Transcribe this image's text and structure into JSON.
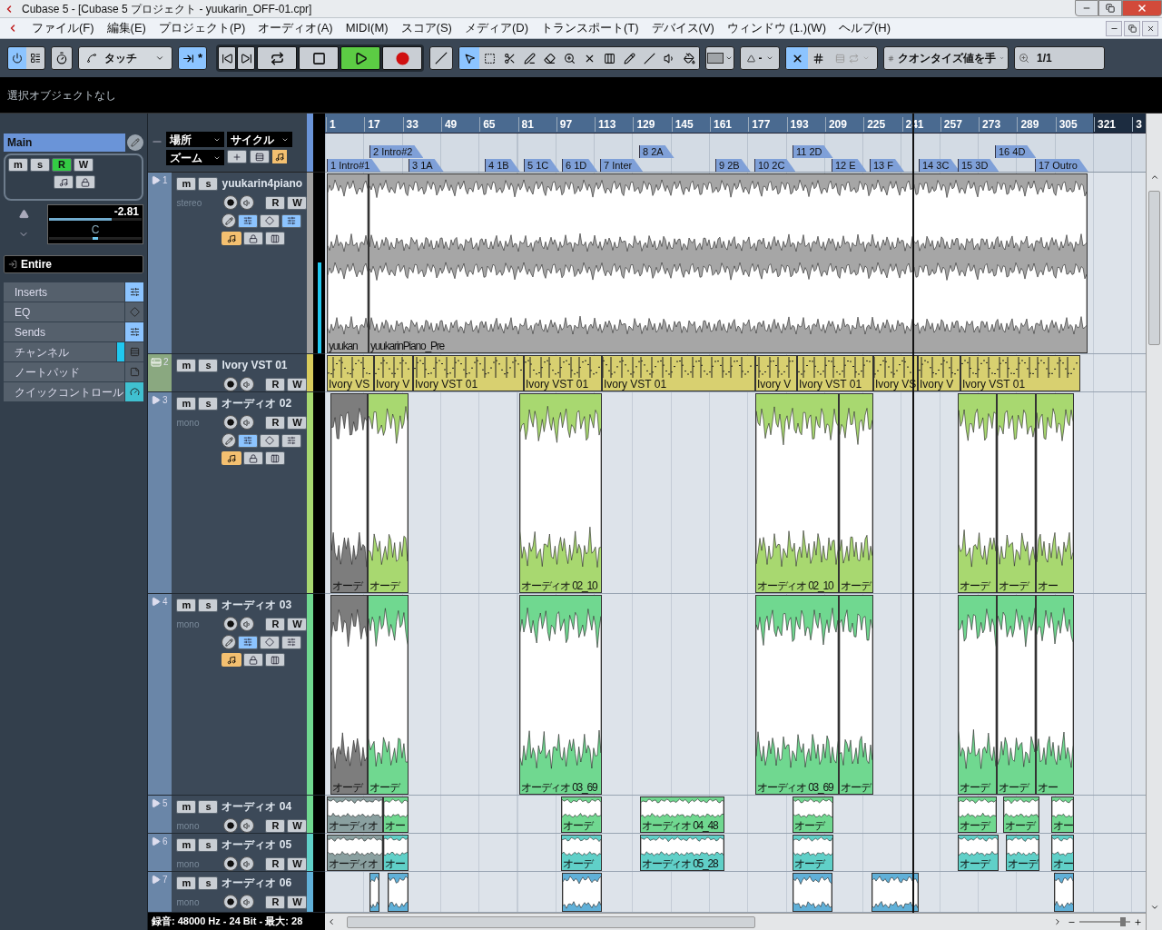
{
  "window": {
    "title": "Cubase 5 - [Cubase 5 プロジェクト - yuukarin_OFF-01.cpr]"
  },
  "menu": [
    "ファイル(F)",
    "編集(E)",
    "プロジェクト(P)",
    "オーディオ(A)",
    "MIDI(M)",
    "スコア(S)",
    "メディア(D)",
    "トランスポート(T)",
    "デバイス(V)",
    "ウィンドウ (1.)(W)",
    "ヘルプ(H)"
  ],
  "toolbar": {
    "automation_mode": "タッチ",
    "autoscroll_mark": "*",
    "autoscroll_on": true,
    "transport": [
      {
        "kind": "to-start",
        "on": false
      },
      {
        "kind": "cycle",
        "on": false
      },
      {
        "kind": "stop",
        "on": false
      },
      {
        "kind": "play",
        "on": true
      },
      {
        "kind": "record",
        "on": false
      }
    ],
    "tools": [
      {
        "kind": "object",
        "selected": true
      },
      {
        "kind": "range",
        "selected": false
      },
      {
        "kind": "split",
        "selected": false
      },
      {
        "kind": "glue",
        "selected": false
      },
      {
        "kind": "erase",
        "selected": false
      },
      {
        "kind": "zoom",
        "selected": false
      },
      {
        "kind": "mute",
        "selected": false
      },
      {
        "kind": "timewarp",
        "selected": false
      },
      {
        "kind": "draw",
        "selected": false
      },
      {
        "kind": "line",
        "selected": false
      },
      {
        "kind": "play",
        "selected": false
      },
      {
        "kind": "color",
        "selected": false
      }
    ],
    "curve_value": "-",
    "snap_on": true,
    "quantize_type": "クオンタイズ値を手",
    "quantize_value": "1/1"
  },
  "info_line": "選択オブジェクトなし",
  "inspector": {
    "track_name": "Main",
    "labels": {
      "mute": "m",
      "solo": "s",
      "read": "R",
      "write": "W"
    },
    "read_on": true,
    "volume": {
      "reading": "-2.81",
      "level": 0.68
    },
    "pan": {
      "reading": "C",
      "level": 0.5
    },
    "routing": "Entire",
    "sections": [
      {
        "label": "Inserts",
        "kind": "inserts"
      },
      {
        "label": "EQ",
        "kind": "eq"
      },
      {
        "label": "Sends",
        "kind": "sends"
      },
      {
        "label": "チャンネル",
        "kind": "channel"
      },
      {
        "label": "ノートパッド",
        "kind": "notepad"
      },
      {
        "label": "クイックコントロール",
        "kind": "quick"
      }
    ]
  },
  "track_list_header": {
    "locate": "場所",
    "cycle": "サイクル",
    "zoom": "ズーム"
  },
  "ruler": {
    "ticks": [
      "1",
      "17",
      "33",
      "49",
      "65",
      "81",
      "97",
      "113",
      "129",
      "145",
      "161",
      "177",
      "193",
      "209",
      "225",
      "241",
      "257",
      "273",
      "289",
      "305",
      "321",
      "3"
    ]
  },
  "markers": [
    {
      "label": "1 Intro#1",
      "upper": false
    },
    {
      "label": "2 Intro#2",
      "upper": true
    },
    {
      "label": "3 1A",
      "upper": false
    },
    {
      "label": "4 1B",
      "upper": false
    },
    {
      "label": "5 1C",
      "upper": false
    },
    {
      "label": "6 1D",
      "upper": false
    },
    {
      "label": "7 Inter",
      "upper": false
    },
    {
      "label": "8 2A",
      "upper": true
    },
    {
      "label": "9 2B",
      "upper": false
    },
    {
      "label": "10 2C",
      "upper": false
    },
    {
      "label": "11 2D",
      "upper": true
    },
    {
      "label": "12 E",
      "upper": false
    },
    {
      "label": "13 F",
      "upper": false
    },
    {
      "label": "14 3C",
      "upper": false
    },
    {
      "label": "15 3D",
      "upper": false
    },
    {
      "label": "16 4D",
      "upper": true
    },
    {
      "label": "17 Outro",
      "upper": false
    }
  ],
  "zoom_slider": {
    "level": 0.85
  },
  "tracks": [
    {
      "number": "1",
      "name": "yuukarin4piano",
      "kind": "audio",
      "channel": "stereo",
      "color": "#a0a0a0",
      "labels": {
        "mute": "m",
        "solo": "s",
        "read": "R",
        "write": "W"
      },
      "inserts_on": true,
      "sends_on": true,
      "events": [
        {
          "label": "yuukan",
          "color": "#a6a6a6"
        },
        {
          "label": "yuukarinPiano_Pre",
          "color": "#a6a6a6"
        }
      ]
    },
    {
      "number": "2",
      "name": "Ivory VST 01",
      "kind": "instrument",
      "color": "#d8cc5c",
      "labels": {
        "mute": "m",
        "solo": "s",
        "read": "R",
        "write": "W"
      },
      "events": [
        {
          "label": "Ivory VS",
          "color": "#d8d070"
        },
        {
          "label": "Ivory V",
          "color": "#d8d070"
        },
        {
          "label": "Ivory VST 01",
          "color": "#d8d070"
        },
        {
          "label": "Ivory VST 01",
          "color": "#d8d070"
        },
        {
          "label": "Ivory VST 01",
          "color": "#d8d070"
        },
        {
          "label": "Ivory V",
          "color": "#d8d070"
        },
        {
          "label": "Ivory VST 01",
          "color": "#d8d070"
        },
        {
          "label": "Ivory VS",
          "color": "#d8d070"
        },
        {
          "label": "Ivory V",
          "color": "#d8d070"
        },
        {
          "label": "Ivory VST 01",
          "color": "#d8d070"
        }
      ]
    },
    {
      "number": "3",
      "name": "オーディオ 02",
      "kind": "audio",
      "channel": "mono",
      "color": "#a8d870",
      "labels": {
        "mute": "m",
        "solo": "s",
        "read": "R",
        "write": "W"
      },
      "inserts_on": true,
      "sends_on": false,
      "events": [
        {
          "label": "オーデ",
          "color": "#7d7d7d"
        },
        {
          "label": "オーデ",
          "color": "#a8d870"
        },
        {
          "label": "オーディオ 02_10",
          "color": "#a8d870"
        },
        {
          "label": "オーディオ 02_10",
          "color": "#a8d870"
        },
        {
          "label": "オーデ",
          "color": "#a8d870"
        },
        {
          "label": "オーデ",
          "color": "#a8d870"
        },
        {
          "label": "オーデ",
          "color": "#a8d870"
        },
        {
          "label": "オー",
          "color": "#a8d870"
        }
      ]
    },
    {
      "number": "4",
      "name": "オーディオ 03",
      "kind": "audio",
      "channel": "mono",
      "color": "#70d890",
      "labels": {
        "mute": "m",
        "solo": "s",
        "read": "R",
        "write": "W"
      },
      "inserts_on": true,
      "sends_on": false,
      "events": [
        {
          "label": "オーデ",
          "color": "#7d7d7d"
        },
        {
          "label": "オーデ",
          "color": "#70d890"
        },
        {
          "label": "オーディオ 03_69",
          "color": "#70d890"
        },
        {
          "label": "オーディオ 03_69",
          "color": "#70d890"
        },
        {
          "label": "オーデ",
          "color": "#70d890"
        },
        {
          "label": "オーデ",
          "color": "#70d890"
        },
        {
          "label": "オーデ",
          "color": "#70d890"
        },
        {
          "label": "オー",
          "color": "#70d890"
        }
      ]
    },
    {
      "number": "5",
      "name": "オーディオ 04",
      "kind": "audio",
      "channel": "mono",
      "color": "#70d890",
      "labels": {
        "mute": "m",
        "solo": "s",
        "read": "R",
        "write": "W"
      },
      "events": [
        {
          "label": "オーディオ",
          "color": "#8aa0a0"
        },
        {
          "label": "オー",
          "color": "#70d890"
        },
        {
          "label": "オーデ",
          "color": "#70d890"
        },
        {
          "label": "オーディオ 04_48",
          "color": "#70d890"
        },
        {
          "label": "オーデ",
          "color": "#70d890"
        },
        {
          "label": "オーデ",
          "color": "#70d890"
        },
        {
          "label": "オーデ",
          "color": "#70d890"
        },
        {
          "label": "オー",
          "color": "#70d890"
        }
      ]
    },
    {
      "number": "6",
      "name": "オーディオ 05",
      "kind": "audio",
      "channel": "mono",
      "color": "#60d0c8",
      "labels": {
        "mute": "m",
        "solo": "s",
        "read": "R",
        "write": "W"
      },
      "events": [
        {
          "label": "オーディオ",
          "color": "#8aa0a0"
        },
        {
          "label": "オー",
          "color": "#60d0c8"
        },
        {
          "label": "オーデ",
          "color": "#60d0c8"
        },
        {
          "label": "オーディオ 05_28",
          "color": "#60d0c8"
        },
        {
          "label": "オーデ",
          "color": "#60d0c8"
        },
        {
          "label": "オーデ",
          "color": "#60d0c8"
        },
        {
          "label": "オーデ",
          "color": "#60d0c8"
        },
        {
          "label": "オー",
          "color": "#60d0c8"
        }
      ]
    },
    {
      "number": "7",
      "name": "オーディオ 06",
      "kind": "audio",
      "channel": "mono",
      "color": "#60b0d8",
      "labels": {
        "mute": "m",
        "solo": "s",
        "read": "R",
        "write": "W"
      },
      "events": [
        {
          "color": "#60b0d8"
        },
        {
          "color": "#60b0d8"
        },
        {
          "color": "#60b0d8"
        },
        {
          "color": "#60b0d8"
        },
        {
          "color": "#60b0d8"
        },
        {
          "color": "#60b0d8"
        }
      ]
    }
  ],
  "status_bar": "録音: 48000 Hz - 24 Bit - 最大: 28"
}
